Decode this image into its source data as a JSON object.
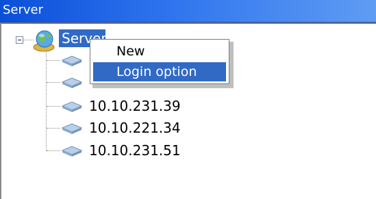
{
  "window": {
    "title": "Server"
  },
  "tree": {
    "root": {
      "label": "Server",
      "icon": "network-globe-icon",
      "expanded": true
    },
    "children": [
      {
        "label": "",
        "icon": "server-icon"
      },
      {
        "label": "",
        "icon": "server-icon"
      },
      {
        "label": "10.10.231.39",
        "icon": "server-icon"
      },
      {
        "label": "10.10.221.34",
        "icon": "server-icon"
      },
      {
        "label": "10.10.231.51",
        "icon": "server-icon"
      }
    ]
  },
  "context_menu": {
    "items": [
      {
        "label": "New",
        "highlighted": false
      },
      {
        "label": "Login option",
        "highlighted": true
      }
    ]
  },
  "colors": {
    "titlebar": "#0a4fd9",
    "selection": "#316ac5",
    "text": "#000000"
  }
}
